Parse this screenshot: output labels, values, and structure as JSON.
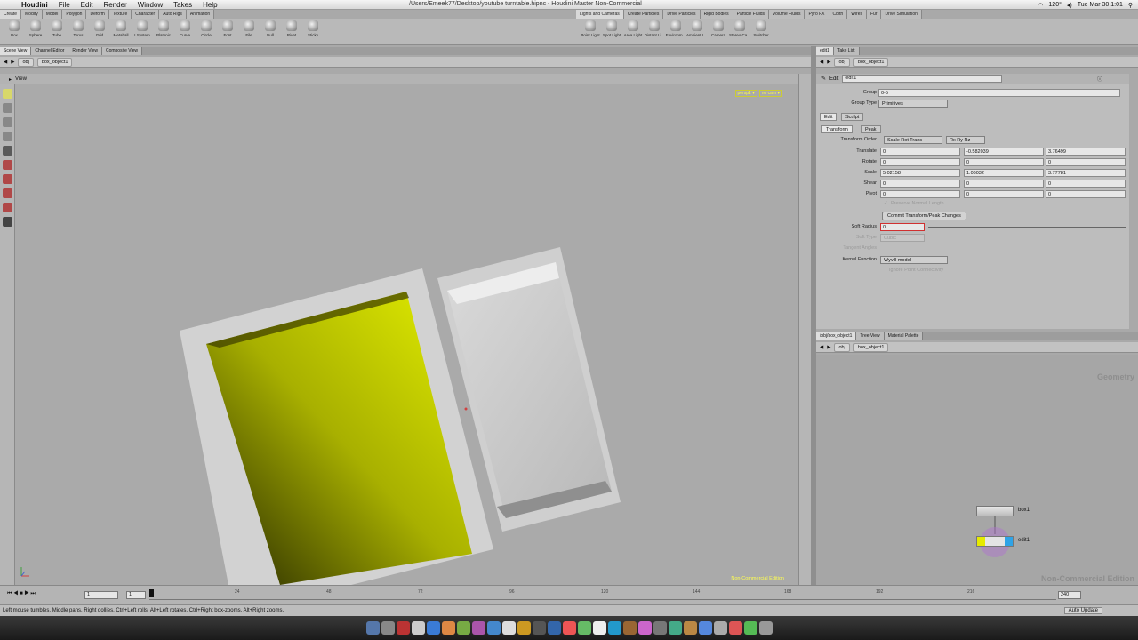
{
  "menubar": {
    "app": "Houdini",
    "items": [
      "File",
      "Edit",
      "Render",
      "Window",
      "Takes",
      "Help"
    ],
    "title": "/Users/Emeek77/Desktop/youtube turntable.hipnc - Houdini Master Non-Commercial",
    "temp": "120°",
    "clock": "Tue Mar 30  1:01"
  },
  "shelf": {
    "tabs_left": [
      "Create",
      "Modify",
      "Model",
      "Polygon",
      "Deform",
      "Texture",
      "Character",
      "Auto Rigs",
      "Animation"
    ],
    "tabs_right": [
      "Lights and Cameras",
      "Create Particles",
      "Drive Particles",
      "Rigid Bodies",
      "Particle Fluids",
      "Volume Fluids",
      "Pyro FX",
      "Cloth",
      "Wires",
      "Fur",
      "Drive Simulation"
    ],
    "tools_left": [
      "Box",
      "Sphere",
      "Tube",
      "Torus",
      "Grid",
      "Metaball",
      "LSystem",
      "Platonic",
      "Curve",
      "Circle",
      "Font",
      "File",
      "Null",
      "Rivet",
      "Sticky"
    ],
    "tools_right": [
      "Point Light",
      "Spot Light",
      "Area Light",
      "Distant Li...",
      "Environm...",
      "Ambient L...",
      "Camera",
      "Stereo Ca...",
      "Switcher"
    ]
  },
  "viewer": {
    "tabs": [
      "Scene View",
      "Channel Editor",
      "Render View",
      "Composite View"
    ],
    "path_root": "obj",
    "path_node": "box_object1",
    "view_label": "View",
    "cam_tags": [
      "persp1 ▾",
      "no cam ▾"
    ],
    "watermark": "Non-Commercial Edition"
  },
  "params": {
    "tabs": [
      "edit1",
      "Take List"
    ],
    "path_root": "obj",
    "path_node": "box_object1",
    "node_type": "Edit",
    "node_name": "edit1",
    "group_label": "Group",
    "group_value": "0-5",
    "group_type_label": "Group Type",
    "group_type_value": "Primitives",
    "mode_tabs": [
      "Edit",
      "Sculpt"
    ],
    "transform_tabs": [
      "Transform",
      "Peak"
    ],
    "transform_order_label": "Transform Order",
    "transform_order_value": "Scale Rot Trans",
    "rot_order_value": "Rx Ry Rz",
    "rows": [
      {
        "label": "Translate",
        "x": "0",
        "y": "-0.582039",
        "z": "3.76499"
      },
      {
        "label": "Rotate",
        "x": "0",
        "y": "0",
        "z": "0"
      },
      {
        "label": "Scale",
        "x": "5.02158",
        "y": "1.06032",
        "z": "3.77781"
      },
      {
        "label": "Shear",
        "x": "0",
        "y": "0",
        "z": "0"
      },
      {
        "label": "Pivot",
        "x": "0",
        "y": "0",
        "z": "0"
      }
    ],
    "preserve_label": "Preserve Normal Length",
    "commit_label": "Commit Transform/Peak Changes",
    "soft_radius_label": "Soft Radius",
    "soft_radius_value": "0",
    "soft_type_label": "Soft Type",
    "soft_type_value": "Cubic",
    "tangent_label": "Tangent Angles",
    "kernel_label": "Kernel Function",
    "kernel_value": "Wyvill model",
    "ignore_label": "Ignore Point Connectivity"
  },
  "network": {
    "tabs": [
      "/obj/box_object1",
      "Tree View",
      "Material Palette"
    ],
    "path_root": "obj",
    "path_node": "box_object1",
    "context_label": "Geometry",
    "nodes": [
      "box1",
      "edit1"
    ],
    "watermark": "Non-Commercial Edition"
  },
  "timeline": {
    "start": "1",
    "current": "1",
    "end": "240",
    "ticks": [
      "24",
      "48",
      "72",
      "96",
      "120",
      "144",
      "168",
      "192",
      "216"
    ]
  },
  "status": {
    "message": "Left mouse tumbles. Middle pans. Right dollies. Ctrl+Left rolls. Alt+Left rotates. Ctrl+Right box-zooms. Alt+Right zooms.",
    "auto_update": "Auto Update"
  },
  "colors": {
    "ui_grey": "#bdbdbd",
    "viewport_bg": "#aaaaaa",
    "selection_yellow": "#d6e600",
    "accent_blue": "#3a7bd5"
  }
}
